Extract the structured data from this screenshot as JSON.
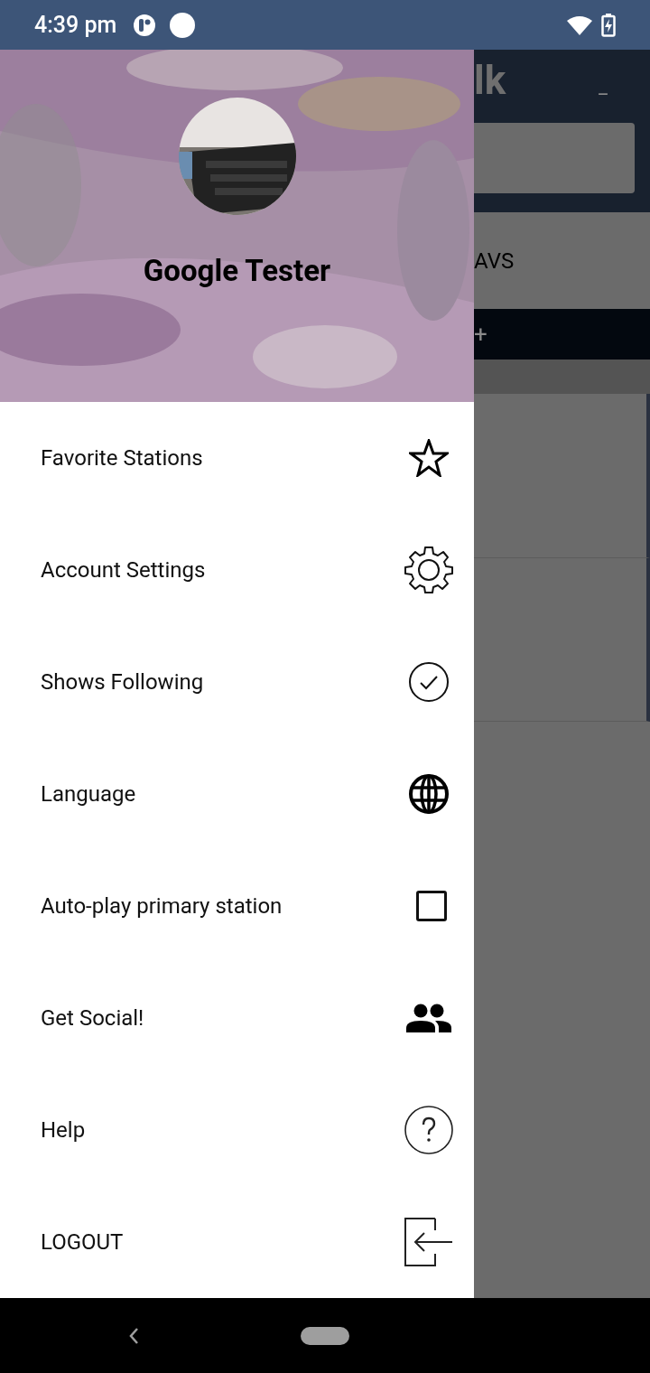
{
  "status_bar": {
    "time": "4:39 pm"
  },
  "background": {
    "title": "lk",
    "minimize": "_",
    "tab": "AVS",
    "add": "+"
  },
  "drawer": {
    "user_name": "Google Tester",
    "items": [
      {
        "kind": "link",
        "label": "Favorite Stations"
      },
      {
        "kind": "link",
        "label": "Account Settings"
      },
      {
        "kind": "link",
        "label": "Shows Following"
      },
      {
        "kind": "link",
        "label": "Language"
      },
      {
        "kind": "checkbox",
        "label": "Auto-play primary station",
        "checked": false
      },
      {
        "kind": "link",
        "label": "Get Social!"
      },
      {
        "kind": "link",
        "label": "Help"
      },
      {
        "kind": "link",
        "label": "LOGOUT"
      }
    ]
  }
}
